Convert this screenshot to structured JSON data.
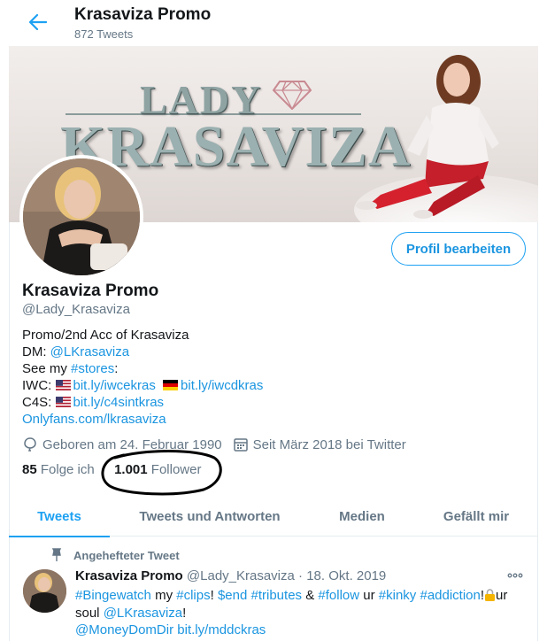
{
  "header": {
    "title": "Krasaviza Promo",
    "tweet_count": "872 Tweets",
    "back_icon": "arrow-left-icon"
  },
  "banner": {
    "logo_top": "LADY",
    "logo_main": "KRASAVIZA"
  },
  "profile": {
    "edit_button": "Profil bearbeiten",
    "name": "Krasaviza Promo",
    "handle": "@Lady_Krasaviza",
    "bio": {
      "line1": "Promo/2nd Acc of Krasaviza",
      "dm_label": "DM: ",
      "dm_link": "@LKrasaviza",
      "see_label": "See my ",
      "see_link": "#stores",
      "see_end": ":",
      "iwc_label": "IWC: ",
      "iwc_link1": "bit.ly/iwcekras",
      "iwc_link2": "bit.ly/iwcdkras",
      "c4s_label": "C4S: ",
      "c4s_link": "bit.ly/c4sintkras",
      "onlyfans_link": "Onlyfans.com/lkrasaviza"
    },
    "born": "Geboren am 24. Februar 1990",
    "joined": "Seit März 2018 bei Twitter",
    "following_count": "85",
    "following_label": "Folge ich",
    "followers_count": "1.001",
    "followers_label": "Follower"
  },
  "tabs": [
    {
      "label": "Tweets",
      "active": true
    },
    {
      "label": "Tweets und Antworten",
      "active": false
    },
    {
      "label": "Medien",
      "active": false
    },
    {
      "label": "Gefällt mir",
      "active": false
    }
  ],
  "tweet": {
    "pinned_label": "Angehefteter Tweet",
    "name": "Krasaviza Promo",
    "handle": "@Lady_Krasaviza",
    "sep": " · ",
    "date": "18. Okt. 2019",
    "line1": {
      "h1": "#Bingewatch",
      "t1": " my ",
      "h2": "#clips",
      "t2": "! ",
      "h3": "$end",
      "t3": " ",
      "h4": "#tributes",
      "t4": " & ",
      "h5": "#follow",
      "t5": " ur ",
      "h6": "#kinky",
      "t6": " ",
      "h7": "#addiction",
      "t7": "!",
      "t8": "ur"
    },
    "line2": {
      "t1": "soul ",
      "h1": "@LKrasaviza",
      "t2": "!"
    },
    "line3": {
      "h1": "@MoneyDomDir",
      "t1": " ",
      "h2": "bit.ly/mddckras"
    }
  },
  "colors": {
    "accent": "#1da1f2",
    "link": "#1b95e0",
    "muted": "#657786"
  }
}
